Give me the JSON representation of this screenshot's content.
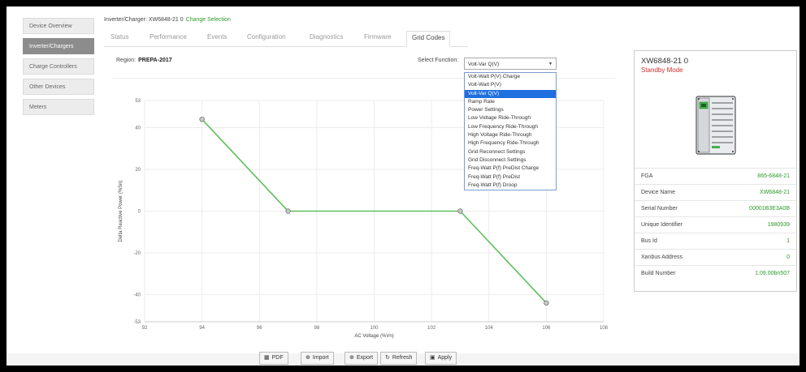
{
  "sidebar": {
    "items": [
      {
        "label": "Device Overview",
        "active": false
      },
      {
        "label": "Inverter/Chargers",
        "active": true
      },
      {
        "label": "Charge Controllers",
        "active": false
      },
      {
        "label": "Other Devices",
        "active": false
      },
      {
        "label": "Meters",
        "active": false
      }
    ]
  },
  "header": {
    "selection_text": "Inverter/Charger: XW6848-21 0",
    "change_link": "Change Selection",
    "tabs": [
      "Status",
      "Performance",
      "Events",
      "Configuration",
      "Diagnostics",
      "Firmware",
      "Grid Codes"
    ],
    "active_tab": "Grid Codes"
  },
  "region": {
    "label": "Region:",
    "value": "PREPA-2017"
  },
  "function_select": {
    "label": "Select Function:",
    "value": "Volt-Var Q(V)",
    "options": [
      "Volt-Watt P(V) Charge",
      "Volt-Watt P(V)",
      "Volt-Var Q(V)",
      "Ramp Rate",
      "Power Settings",
      "Low Voltage Ride-Through",
      "Low Frequency Ride-Through",
      "High Voltage Ride-Through",
      "High Frequency Ride-Through",
      "Grid Reconnect Settings",
      "Grid Disconnect Settings",
      "Freq-Watt P(f) PreDist Charge",
      "Freq-Watt P(f) PreDist",
      "Freq-Watt P(f) Droop"
    ]
  },
  "chart_data": {
    "type": "line",
    "xlabel": "AC Voltage (%Vn)",
    "ylabel": "Delta Reactive Power (%Sn)",
    "xlim": [
      92,
      108
    ],
    "ylim": [
      -53,
      53
    ],
    "xticks": [
      92,
      94,
      96,
      98,
      100,
      102,
      104,
      106,
      108
    ],
    "yticks": [
      -53,
      -40,
      -20,
      0,
      20,
      40,
      53
    ],
    "grid": true,
    "series": [
      {
        "x": [
          94,
          97,
          103,
          106
        ],
        "y": [
          44,
          0,
          0,
          -44
        ],
        "color": "#5cc05c"
      }
    ]
  },
  "buttons": [
    {
      "label": "PDF",
      "icon": "▦"
    },
    {
      "label": "Import",
      "icon": "⊕"
    },
    {
      "label": "Export",
      "icon": "⊕"
    },
    {
      "label": "Refresh",
      "icon": "↻"
    },
    {
      "label": "Apply",
      "icon": "▣"
    }
  ],
  "device_panel": {
    "title": "XW6848-21 0",
    "mode": "Standby Mode",
    "properties": [
      {
        "key": "FGA",
        "value": "865-6848-21"
      },
      {
        "key": "Device Name",
        "value": "XW6848-21"
      },
      {
        "key": "Serial Number",
        "value": "00001B3E3A0B"
      },
      {
        "key": "Unique Identifier",
        "value": "1980939"
      },
      {
        "key": "Bus Id",
        "value": "1"
      },
      {
        "key": "Xanbus Address",
        "value": "0"
      },
      {
        "key": "Build Number",
        "value": "1.09.00bn507"
      }
    ]
  },
  "colors": {
    "accent_green": "#2a9a2a",
    "mode_red": "#d0312d",
    "line_green": "#5cc05c",
    "selected_blue": "#1e6fe0"
  }
}
